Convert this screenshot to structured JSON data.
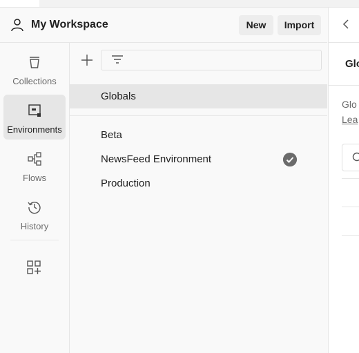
{
  "header": {
    "workspace_name": "My Workspace",
    "new_label": "New",
    "import_label": "Import"
  },
  "sidebar": {
    "items": [
      {
        "label": "Collections",
        "icon": "trash-can-icon"
      },
      {
        "label": "Environments",
        "icon": "environment-icon",
        "active": true
      },
      {
        "label": "Flows",
        "icon": "flows-icon"
      },
      {
        "label": "History",
        "icon": "history-icon"
      }
    ],
    "extra_icon": "add-widget-icon"
  },
  "list": {
    "filter_placeholder": "",
    "globals_label": "Globals",
    "environments": [
      {
        "name": "Beta",
        "active": false
      },
      {
        "name": "NewsFeed Environment",
        "active": true
      },
      {
        "name": "Production",
        "active": false
      }
    ]
  },
  "right_panel": {
    "title": "Glo",
    "text": "Glo",
    "link": "Lea"
  },
  "colors": {
    "accent_check": "#6b6b6b",
    "selected_row": "#e6e6e6",
    "background": "#f9f9f9"
  }
}
